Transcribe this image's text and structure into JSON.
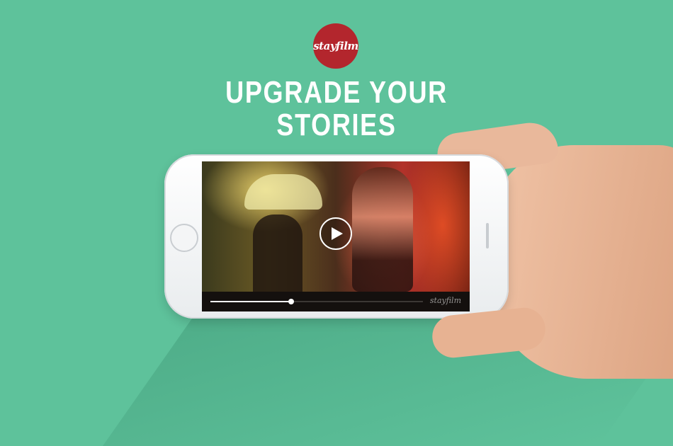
{
  "brand": {
    "logo_text": "stayfilm"
  },
  "headline": {
    "line1": "UPGRADE YOUR",
    "line2": "STORIES"
  },
  "video": {
    "progress": 0.38,
    "watermark": "stayfilm"
  },
  "colors": {
    "background": "#5ec29b",
    "logo_red": "#b3262d",
    "text": "#ffffff"
  },
  "icons": [
    "play-icon"
  ]
}
